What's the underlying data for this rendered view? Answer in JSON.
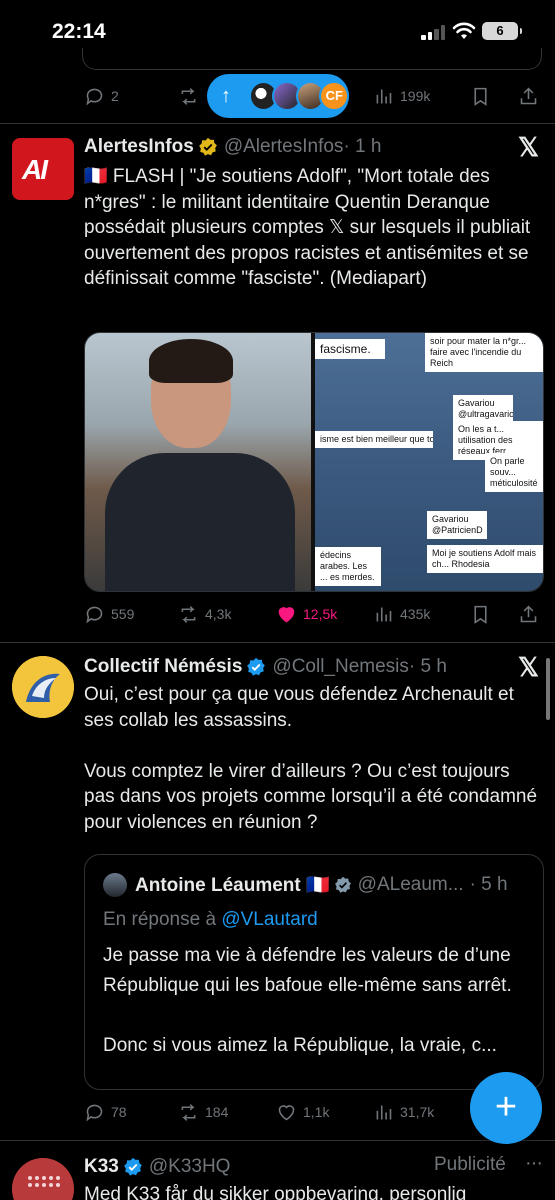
{
  "status_bar": {
    "time": "22:14",
    "battery": "6"
  },
  "top_post_actions": {
    "replies": "2",
    "views": "199k"
  },
  "new_posts_pill": {
    "arrow": "↑",
    "logo_text": "CF"
  },
  "post1": {
    "avatar_text": "AI",
    "name": "AlertesInfos",
    "handle": "@AlertesInfos",
    "time": "· 1 h",
    "text": "🇫🇷 FLASH | \"Je soutiens Adolf\", \"Mort totale des n*gres\" : le militant identitaire Quentin Deranque possédait plusieurs comptes 𝕏 sur lesquels il publiait ouvertement des propos racistes et antisémites et se définissait comme \"fasciste\". (Mediapart)",
    "media_snippets": [
      "fascisme.",
      "soir pour mater la n*gr... faire avec l'incendie du Reich",
      "Gavariou @ultragavariou",
      "On les a t... utilisation des réseaux ferr...",
      "isme est bien meilleur que ton",
      "On parle souv... méticulosité",
      "Gavariou @PatricienD",
      "Moi je soutiens Adolf mais ch... Rhodesia",
      "édecins arabes. Les ... es merdes."
    ],
    "replies": "559",
    "reposts": "4,3k",
    "likes": "12,5k",
    "views": "435k"
  },
  "post2": {
    "name": "Collectif Némésis",
    "handle": "@Coll_Nemesis",
    "time": "· 5 h",
    "text": "Oui, c’est pour ça que vous défendez Archenault et ses collab les assassins.\n\nVous comptez le virer d’ailleurs ? Ou c’est toujours pas dans vos projets comme lorsqu’il a été condamné pour violences en réunion ?",
    "quote": {
      "name": "Antoine Léaument 🇫🇷",
      "handle": "@ALeaum...",
      "time": "· 5 h",
      "reply_prefix": "En réponse à",
      "reply_mention": "@VLautard",
      "text": "Je passe ma vie à défendre les valeurs de d’une République qui les bafoue elle-même sans arrêt.\n\nDonc si vous aimez la République, la vraie, c..."
    },
    "replies": "78",
    "reposts": "184",
    "likes": "1,1k",
    "views": "31,7k"
  },
  "post3": {
    "name": "K33",
    "handle": "@K33HQ",
    "ad_label": "Publicité",
    "more": "···",
    "text": "Med K33 får du sikker oppbevaring, personlig"
  },
  "fab": {
    "label": "+"
  },
  "colors": {
    "accent": "#1d9bf0",
    "like": "#f91880",
    "muted": "#71767b",
    "border": "#2f3336"
  }
}
